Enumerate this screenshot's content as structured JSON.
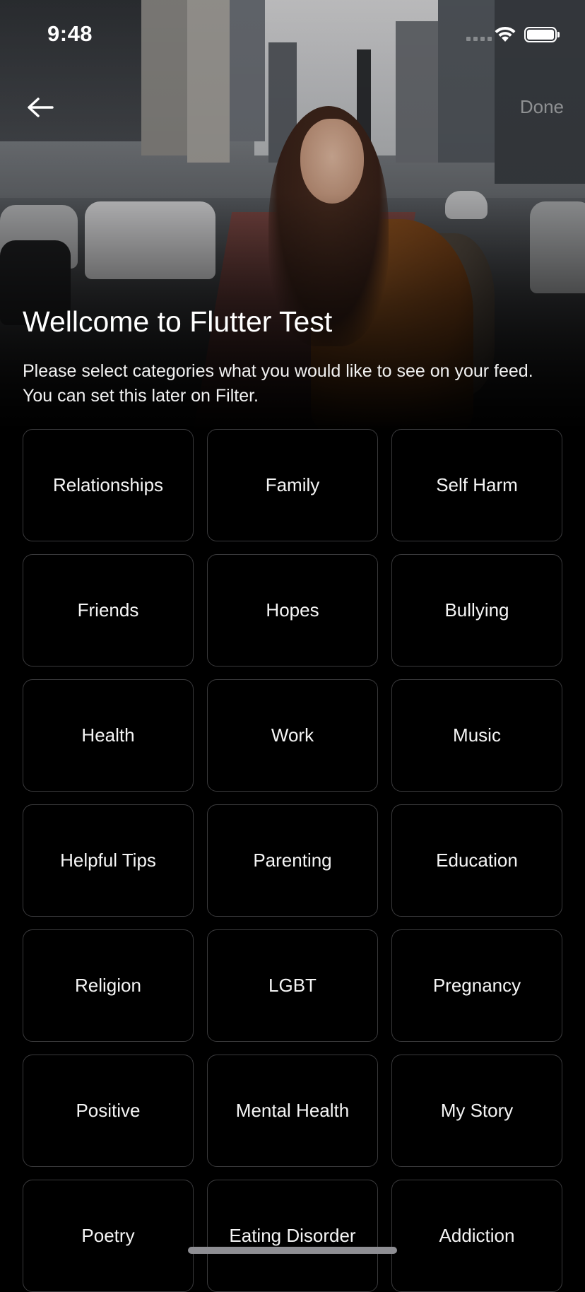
{
  "status_bar": {
    "time": "9:48"
  },
  "nav": {
    "back_icon": "arrow-left-icon",
    "done_label": "Done"
  },
  "header": {
    "title": "Wellcome to Flutter Test",
    "subtitle": "Please select categories what you would like to see on your feed. You can set this later on Filter."
  },
  "categories": [
    "Relationships",
    "Family",
    "Self Harm",
    "Friends",
    "Hopes",
    "Bullying",
    "Health",
    "Work",
    "Music",
    "Helpful Tips",
    "Parenting",
    "Education",
    "Religion",
    "LGBT",
    "Pregnancy",
    "Positive",
    "Mental Health",
    "My Story",
    "Poetry",
    "Eating Disorder",
    "Addiction"
  ],
  "colors": {
    "background": "#000000",
    "tile_border": "#3a3a3c",
    "done_text": "#8a8a8a"
  }
}
